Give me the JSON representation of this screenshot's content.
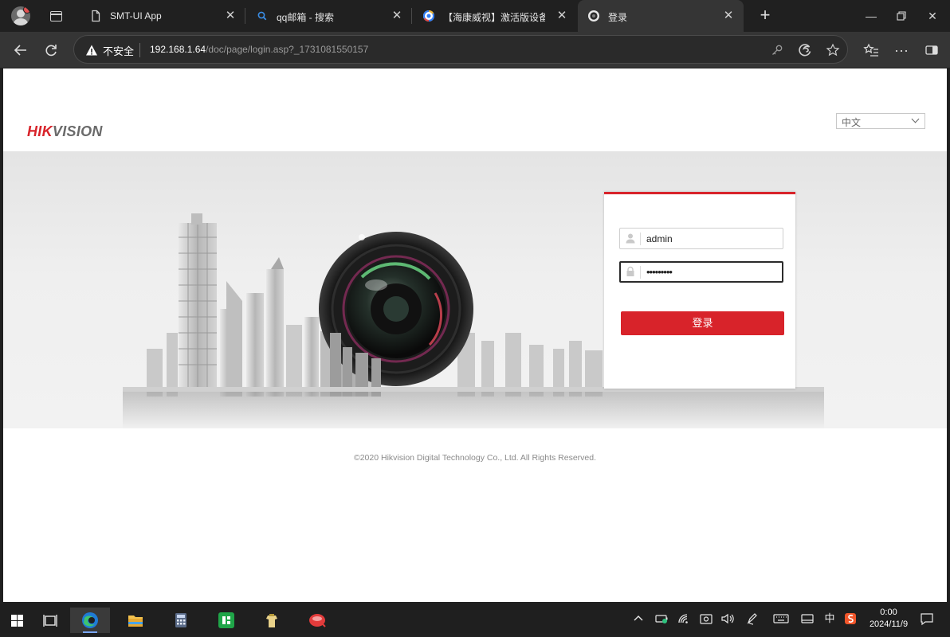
{
  "browser": {
    "tabs": [
      {
        "title": "SMT-UI App",
        "icon": "document-icon"
      },
      {
        "title": "qq邮箱 - 搜索",
        "icon": "search-icon"
      },
      {
        "title": "【海康威视】激活版设备密",
        "icon": "baidu-icon"
      },
      {
        "title": "登录",
        "icon": "camera-icon",
        "active": true
      }
    ],
    "new_tab": "+",
    "address": {
      "security_label": "不安全",
      "host": "192.168.1.64",
      "path": "/doc/page/login.asp?_1731081550157"
    }
  },
  "page": {
    "brand": {
      "hik": "HIK",
      "vision": "VISION"
    },
    "language": {
      "selected": "中文"
    },
    "login": {
      "username": "admin",
      "password_mask": "•••••••••",
      "submit_label": "登录"
    },
    "copyright": "©2020 Hikvision Digital Technology Co., Ltd. All Rights Reserved."
  },
  "taskbar": {
    "ime": "中",
    "time": "0:00",
    "date": "2024/11/9"
  },
  "colors": {
    "brand_red": "#d8232a",
    "browser_dark": "#202020",
    "toolbar": "#353535"
  }
}
